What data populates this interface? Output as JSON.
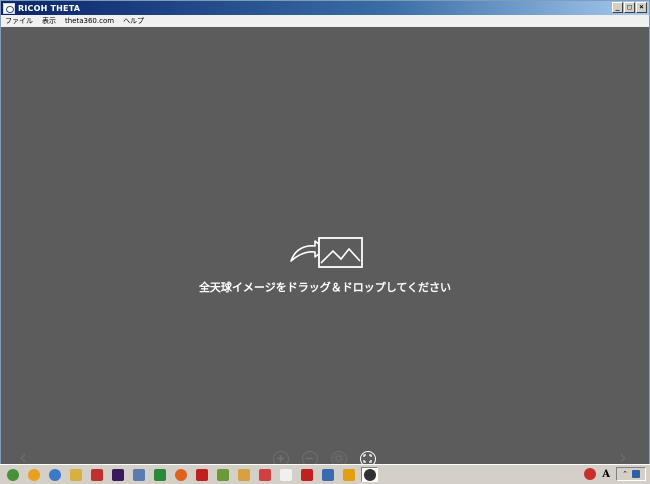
{
  "window": {
    "title": "RICOH THETA",
    "controls": {
      "minimize": "_",
      "maximize": "□",
      "close": "×"
    }
  },
  "menu": [
    {
      "label": "ファイル"
    },
    {
      "label": "表示"
    },
    {
      "label": "theta360.com"
    },
    {
      "label": "ヘルプ"
    }
  ],
  "viewer": {
    "drop_message": "全天球イメージをドラッグ＆ドロップしてください",
    "drop_icon": "share-image-icon",
    "nav_prev_glyph": "‹",
    "nav_next_glyph": "›",
    "zoom_controls": [
      "zoom-in-icon",
      "zoom-out-icon",
      "settings-icon",
      "fullscreen-icon"
    ],
    "background_color": "#5c5c5c"
  },
  "taskbar": {
    "apps": [
      {
        "icon": "chrome-icon",
        "color": "#4a8f3c"
      },
      {
        "icon": "orb-icon",
        "color": "#e8a020"
      },
      {
        "icon": "globe-icon",
        "color": "#3a7ac8"
      },
      {
        "icon": "folder-icon",
        "color": "#d8b040"
      },
      {
        "icon": "diamond-icon",
        "color": "#c03030"
      },
      {
        "icon": "premiere-icon",
        "color": "#3a1a5a"
      },
      {
        "icon": "window-icon",
        "color": "#5a7ab0"
      },
      {
        "icon": "spreadsheet-icon",
        "color": "#2a8a3a"
      },
      {
        "icon": "firefox-icon",
        "color": "#e06020"
      },
      {
        "icon": "record-icon",
        "color": "#c02020"
      },
      {
        "icon": "person-icon",
        "color": "#6a9a3a"
      },
      {
        "icon": "explorer-icon",
        "color": "#d8a040"
      },
      {
        "icon": "paint-icon",
        "color": "#d04040"
      },
      {
        "icon": "text-icon",
        "color": "#f0f0f0"
      },
      {
        "icon": "pdf-icon",
        "color": "#c02020"
      },
      {
        "icon": "monitor-icon",
        "color": "#3a6ab0"
      },
      {
        "icon": "media-icon",
        "color": "#e0a010"
      },
      {
        "icon": "theta-icon",
        "color": "#303030"
      }
    ],
    "tray_glyph": "A",
    "tray_arrows": "⌃"
  }
}
